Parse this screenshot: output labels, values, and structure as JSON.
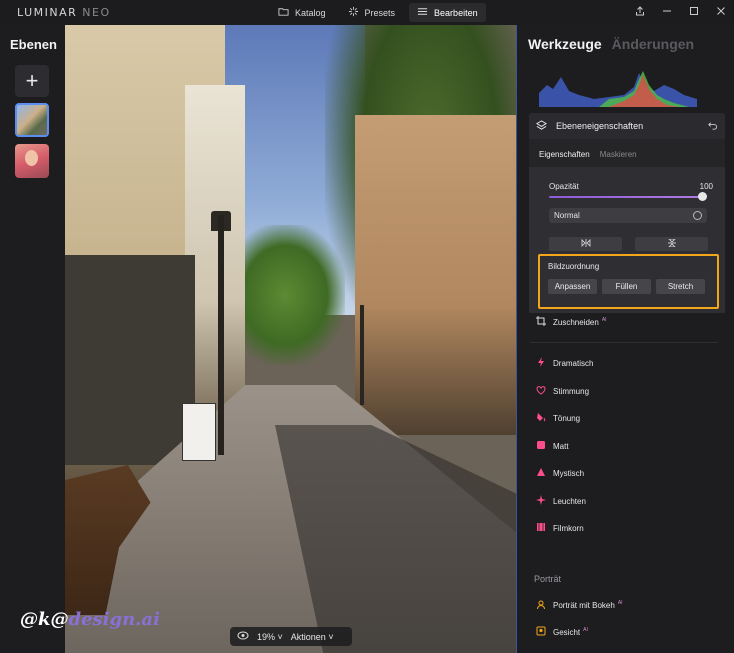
{
  "app": {
    "logo_main": "LUMINAR",
    "logo_sub": "NEO"
  },
  "topnav": [
    {
      "label": "Katalog",
      "icon": "folder-icon",
      "active": false
    },
    {
      "label": "Presets",
      "icon": "presets-icon",
      "active": false
    },
    {
      "label": "Bearbeiten",
      "icon": "edit-sliders-icon",
      "active": true
    }
  ],
  "left_panel": {
    "title": "Ebenen",
    "add_label": "+"
  },
  "photo_bar": {
    "zoom": "19%",
    "actions": "Aktionen"
  },
  "watermark": {
    "prefix": "@k@",
    "domain": "design.ai"
  },
  "right_panel": {
    "tabs": {
      "tools": "Werkzeuge",
      "changes": "Änderungen"
    },
    "layer_props": {
      "title": "Ebeneneigenschaften",
      "subtabs": {
        "properties": "Eigenschaften",
        "masking": "Maskieren"
      },
      "opacity_label": "Opazität",
      "opacity_value": "100",
      "opacity_level": 1.0,
      "blend_mode": "Normal",
      "image_mapping_label": "Bildzuordnung",
      "mapping_buttons": [
        "Anpassen",
        "Füllen",
        "Stretch"
      ]
    },
    "tools": [
      {
        "label": "Zuschneiden",
        "ai": "AI",
        "icon": "crop-icon",
        "color": "#e6e6e6"
      },
      {
        "label": "Dramatisch",
        "icon": "lightning-icon",
        "color": "#ff4d8a"
      },
      {
        "label": "Stimmung",
        "icon": "mood-icon",
        "color": "#ff4d8a"
      },
      {
        "label": "Tönung",
        "icon": "toning-icon",
        "color": "#ff4d8a"
      },
      {
        "label": "Matt",
        "icon": "matte-icon",
        "color": "#ff4d8a"
      },
      {
        "label": "Mystisch",
        "icon": "mystic-icon",
        "color": "#ff4d8a"
      },
      {
        "label": "Leuchten",
        "icon": "glow-icon",
        "color": "#ff4d8a"
      },
      {
        "label": "Filmkorn",
        "icon": "film-grain-icon",
        "color": "#ff4d8a"
      }
    ],
    "portrait_section": "Porträt",
    "portrait_tools": [
      {
        "label": "Porträt mit Bokeh",
        "ai": "AI",
        "icon": "bokeh-icon"
      },
      {
        "label": "Gesicht",
        "ai": "AI",
        "icon": "face-icon"
      }
    ]
  },
  "colors": {
    "accent": "#f2a71b",
    "slider": "#8a5cd8",
    "tool_icon": "#ff4d8a",
    "active_border": "#5c8df0"
  }
}
